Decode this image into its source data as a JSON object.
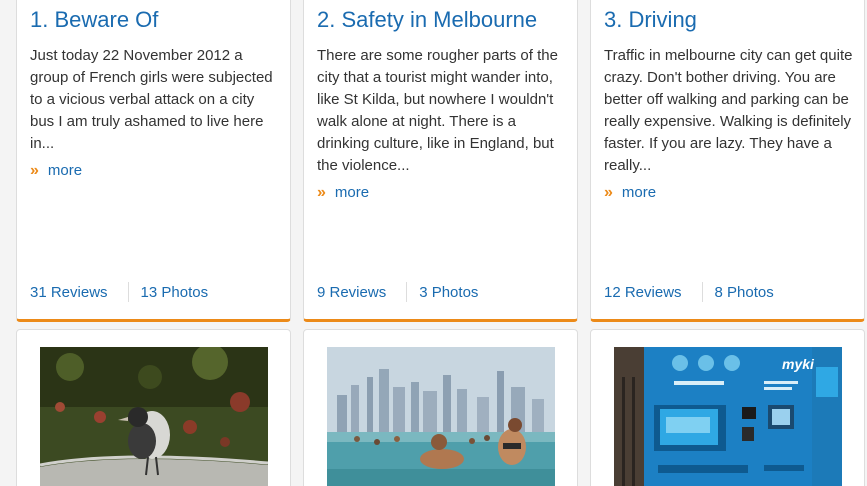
{
  "cards": [
    {
      "title": "1. Beware Of",
      "text": "Just today 22 November 2012 a group of French girls were subjected to a vicious verbal attack on a city bus I am truly ashamed to live here in...",
      "more": "more",
      "reviews": "31 Reviews",
      "photos": "13 Photos"
    },
    {
      "title": "2. Safety in Melbourne",
      "text": "There are some rougher parts of the city that a tourist might wander into, like St Kilda, but nowhere I wouldn't walk alone at night. There is a drinking culture, like in England, but the violence...",
      "more": "more",
      "reviews": "9 Reviews",
      "photos": "3 Photos"
    },
    {
      "title": "3. Driving",
      "text": "Traffic in melbourne city can get quite crazy. Don't bother driving. You are better off walking and parking can be really expensive. Walking is definitely faster. If you are lazy. They have a really...",
      "more": "more",
      "reviews": "12 Reviews",
      "photos": "8 Photos"
    }
  ],
  "photo_tiles": [
    {
      "icon": "magpie-bird-photo"
    },
    {
      "icon": "beach-city-skyline-photo"
    },
    {
      "icon": "myki-ticket-machine-photo"
    }
  ],
  "colors": {
    "link": "#1a6bb0",
    "accent": "#ec8a18",
    "text": "#333333"
  }
}
